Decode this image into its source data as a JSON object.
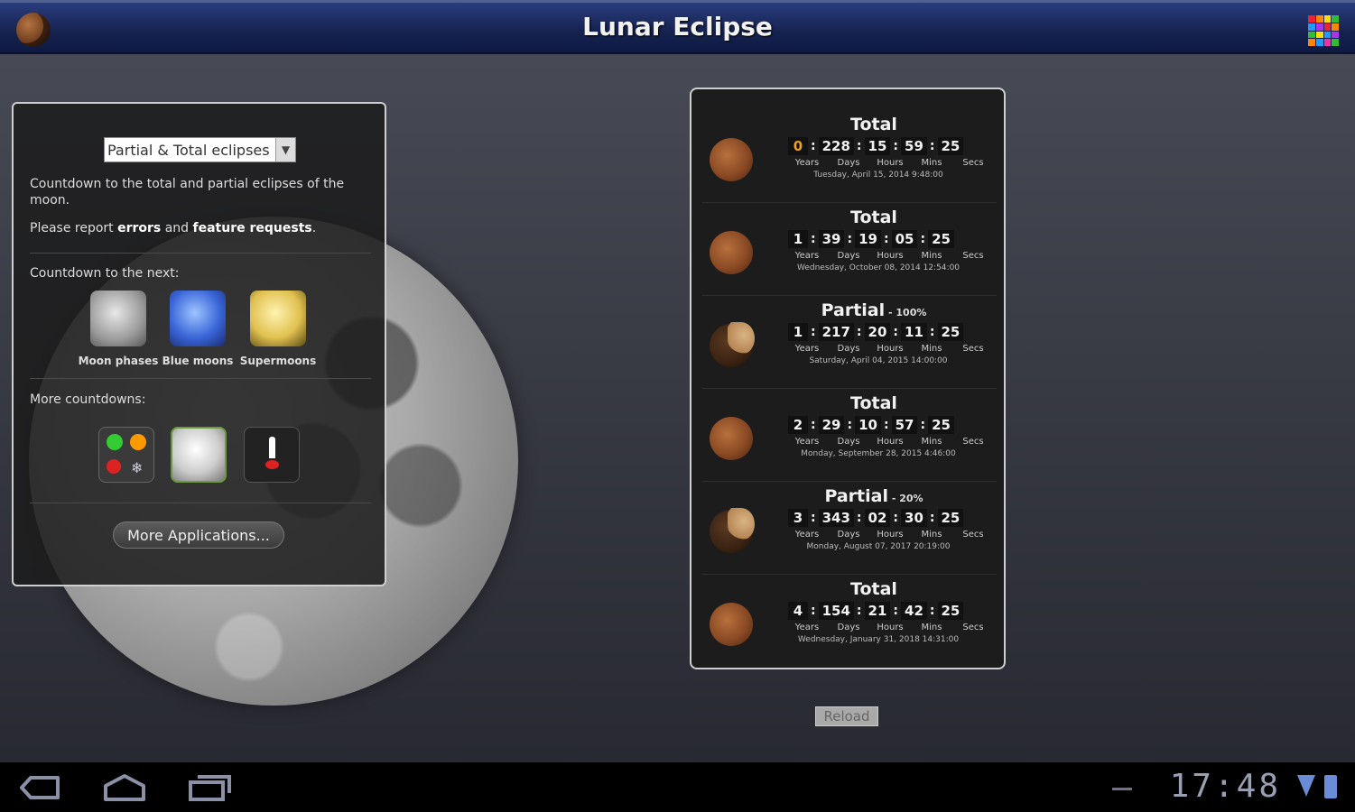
{
  "header": {
    "title": "Lunar Eclipse"
  },
  "left": {
    "dropdown_value": "Partial & Total eclipses",
    "description": "Countdown to the total and partial eclipses of the moon.",
    "report_prefix": "Please report ",
    "report_errors": "errors",
    "report_and": " and ",
    "report_features": "feature requests",
    "report_suffix": ".",
    "countdown_next_label": "Countdown to the next:",
    "tiles": [
      {
        "label": "Moon phases",
        "icon": "moon-phases-icon"
      },
      {
        "label": "Blue moons",
        "icon": "blue-moon-icon"
      },
      {
        "label": "Supermoons",
        "icon": "supermoon-icon"
      }
    ],
    "more_countdowns_label": "More countdowns:",
    "more_tiles": [
      "seasons-icon",
      "golf-ball-icon",
      "candle-icon"
    ],
    "more_apps_label": "More Applications..."
  },
  "eclipses": [
    {
      "type": "Total",
      "pct": "",
      "kind": "total",
      "years": "0",
      "days": "228",
      "hours": "15",
      "mins": "59",
      "secs": "25",
      "date": "Tuesday, April 15, 2014 9:48:00",
      "highlight_years": true
    },
    {
      "type": "Total",
      "pct": "",
      "kind": "total",
      "years": "1",
      "days": "39",
      "hours": "19",
      "mins": "05",
      "secs": "25",
      "date": "Wednesday, October 08, 2014 12:54:00",
      "highlight_years": false
    },
    {
      "type": "Partial",
      "pct": " - 100%",
      "kind": "partial",
      "years": "1",
      "days": "217",
      "hours": "20",
      "mins": "11",
      "secs": "25",
      "date": "Saturday, April 04, 2015 14:00:00",
      "highlight_years": false
    },
    {
      "type": "Total",
      "pct": "",
      "kind": "total",
      "years": "2",
      "days": "29",
      "hours": "10",
      "mins": "57",
      "secs": "25",
      "date": "Monday, September 28, 2015 4:46:00",
      "highlight_years": false
    },
    {
      "type": "Partial",
      "pct": " - 20%",
      "kind": "partial",
      "years": "3",
      "days": "343",
      "hours": "02",
      "mins": "30",
      "secs": "25",
      "date": "Monday, August 07, 2017 20:19:00",
      "highlight_years": false
    },
    {
      "type": "Total",
      "pct": "",
      "kind": "total",
      "years": "4",
      "days": "154",
      "hours": "21",
      "mins": "42",
      "secs": "25",
      "date": "Wednesday, January 31, 2018 14:31:00",
      "highlight_years": false
    }
  ],
  "units": [
    "Years",
    "Days",
    "Hours",
    "Mins",
    "Secs"
  ],
  "reload_label": "Reload",
  "status": {
    "clock": "17:48"
  }
}
